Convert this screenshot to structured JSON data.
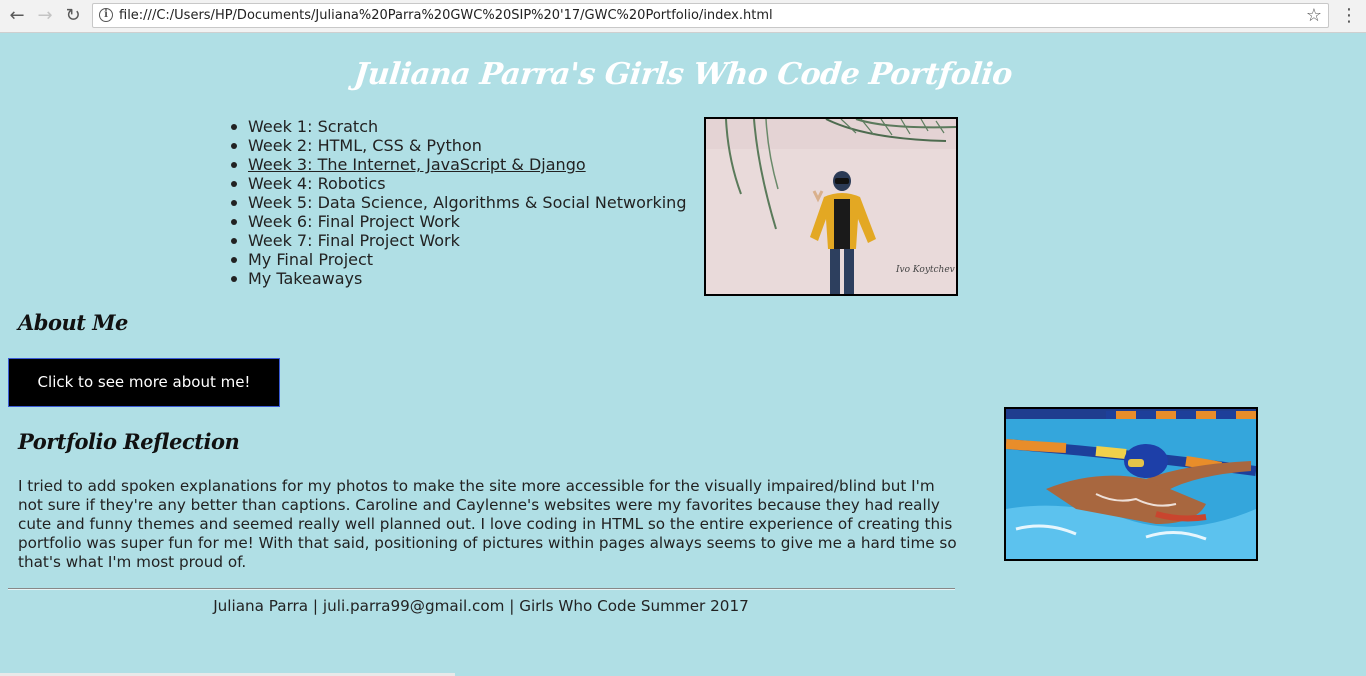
{
  "browser": {
    "back_icon": "arrow-left-icon",
    "forward_icon": "arrow-right-icon",
    "reload_icon": "reload-icon",
    "url": "file:///C:/Users/HP/Documents/Juliana%20Parra%20GWC%20SIP%20'17/GWC%20Portfolio/index.html"
  },
  "page": {
    "title": "Juliana Parra's Girls Who Code Portfolio",
    "weeks": [
      {
        "label": "Week 1: Scratch"
      },
      {
        "label": "Week 2: HTML, CSS & Python"
      },
      {
        "label": "Week 3: The Internet, JavaScript & Django"
      },
      {
        "label": "Week 4: Robotics"
      },
      {
        "label": "Week 5: Data Science, Algorithms & Social Networking"
      },
      {
        "label": "Week 6: Final Project Work"
      },
      {
        "label": "Week 7: Final Project Work"
      },
      {
        "label": "My Final Project"
      },
      {
        "label": "My Takeaways"
      }
    ],
    "photo1_signature": "Ivo Koytchev",
    "about_heading": "About Me",
    "about_button": "Click to see more about me!",
    "reflection_heading": "Portfolio Reflection",
    "reflection_text": "I tried to add spoken explanations for my photos to make the site more accessible for the visually impaired/blind but I'm not sure if they're any better than captions. Caroline and Caylenne's websites were my favorites because they had really cute and funny themes and seemed really well planned out. I love coding in HTML so the entire experience of creating this portfolio was super fun for me! With that said, positioning of pictures within pages always seems to give me a hard time so that's what I'm most proud of.",
    "footer": "Juliana Parra | juli.parra99@gmail.com | Girls Who Code Summer 2017"
  },
  "colors": {
    "background": "#b0dfe5",
    "title": "#ffffff",
    "button_bg": "#000000"
  }
}
